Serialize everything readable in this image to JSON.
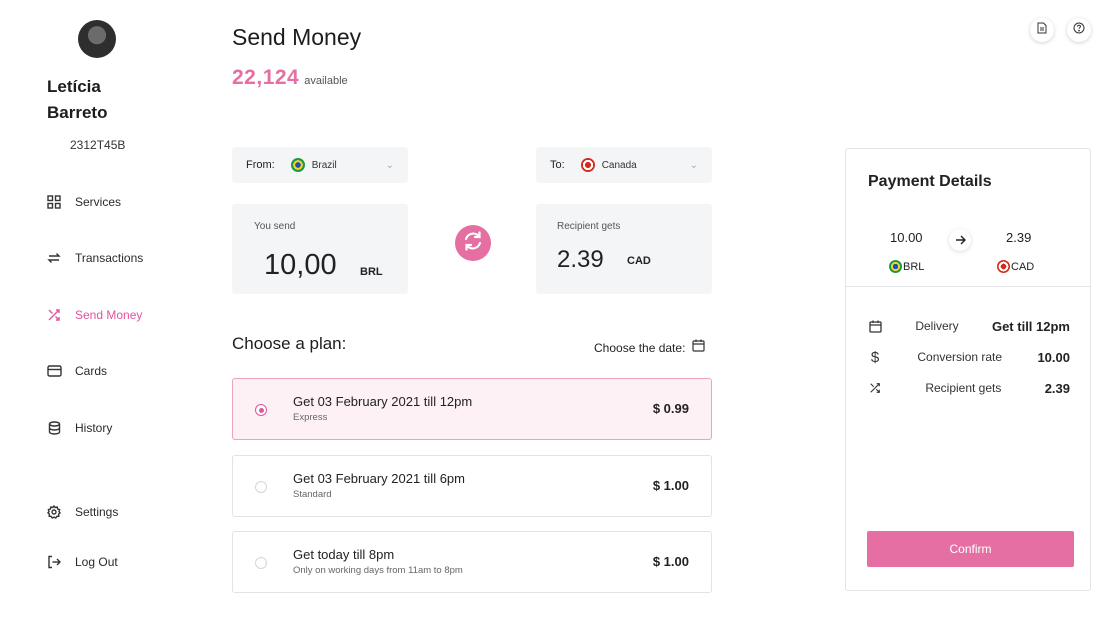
{
  "user": {
    "first_name": "Letícia",
    "last_name": "Barreto",
    "id": "2312T45B"
  },
  "nav": {
    "items": [
      {
        "label": "Services",
        "icon": "grid-icon"
      },
      {
        "label": "Transactions",
        "icon": "transfer-icon"
      },
      {
        "label": "Send Money",
        "icon": "shuffle-icon",
        "active": true
      },
      {
        "label": "Cards",
        "icon": "card-icon"
      },
      {
        "label": "History",
        "icon": "database-icon"
      }
    ],
    "bottom": [
      {
        "label": "Settings",
        "icon": "gear-icon"
      },
      {
        "label": "Log Out",
        "icon": "logout-icon"
      }
    ]
  },
  "header": {
    "title": "Send Money",
    "balance": "22,124",
    "balance_label": "available"
  },
  "transfer": {
    "from_label": "From:",
    "from_country": "Brazil",
    "to_label": "To:",
    "to_country": "Canada",
    "send_label": "You send",
    "send_amount": "10,00",
    "send_currency": "BRL",
    "receive_label": "Recipient gets",
    "receive_amount": "2.39",
    "receive_currency": "CAD"
  },
  "plans_section": {
    "title": "Choose a plan:",
    "date_label": "Choose the date:",
    "plans": [
      {
        "title": "Get 03 February 2021 till 12pm",
        "subtitle": "Express",
        "price": "$ 0.99",
        "selected": true
      },
      {
        "title": "Get 03 February 2021 till 6pm",
        "subtitle": "Standard",
        "price": "$ 1.00",
        "selected": false
      },
      {
        "title": "Get today till 8pm",
        "subtitle": "Only on working days from 11am to 8pm",
        "price": "$ 1.00",
        "selected": false
      }
    ]
  },
  "payment": {
    "title": "Payment Details",
    "from_amount": "10.00",
    "from_currency": "BRL",
    "to_amount": "2.39",
    "to_currency": "CAD",
    "rows": [
      {
        "label": "Delivery",
        "value": "Get till 12pm",
        "icon": "calendar-icon"
      },
      {
        "label": "Conversion rate",
        "value": "10.00",
        "icon": "dollar-icon"
      },
      {
        "label": "Recipient gets",
        "value": "2.39",
        "icon": "shuffle-icon"
      }
    ],
    "confirm_label": "Confirm"
  },
  "colors": {
    "accent": "#e56fa2",
    "accent_text": "#e0559b",
    "panel_bg": "#f4f5f7",
    "selected_bg": "#fdf1f5"
  }
}
